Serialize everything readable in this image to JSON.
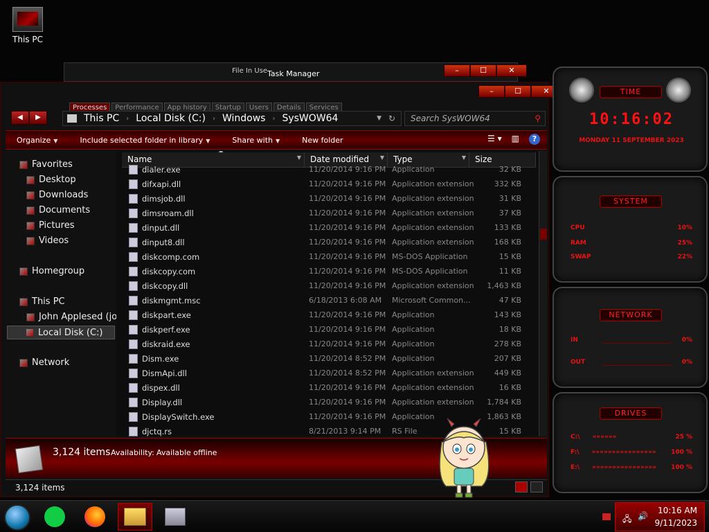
{
  "desktop": {
    "this_pc_label": "This PC"
  },
  "bg_windows": {
    "file_in_use": "File In Use",
    "task_manager": "Task Manager",
    "tm_tabs": [
      "Processes",
      "Performance",
      "App history",
      "Startup",
      "Users",
      "Details",
      "Services"
    ]
  },
  "address": {
    "crumbs": [
      "This PC",
      "Local Disk (C:)",
      "Windows",
      "SysWOW64"
    ],
    "search_placeholder": "Search SysWOW64"
  },
  "cmdbar": {
    "organize": "Organize",
    "include": "Include selected folder in library",
    "share": "Share with",
    "new_folder": "New folder"
  },
  "nav": {
    "favorites": "Favorites",
    "desktop": "Desktop",
    "downloads": "Downloads",
    "documents": "Documents",
    "pictures": "Pictures",
    "videos": "Videos",
    "homegroup": "Homegroup",
    "this_pc": "This PC",
    "user": "John Applesed (joh",
    "local_disk": "Local Disk (C:)",
    "network": "Network"
  },
  "columns": {
    "name": "Name",
    "date": "Date modified",
    "type": "Type",
    "size": "Size"
  },
  "files": [
    {
      "name": "dialer.exe",
      "date": "11/20/2014 9:16 PM",
      "type": "Application",
      "size": "32 KB",
      "icon": "exe-icon"
    },
    {
      "name": "difxapi.dll",
      "date": "11/20/2014 9:16 PM",
      "type": "Application extension",
      "size": "332 KB",
      "icon": "dll-icon"
    },
    {
      "name": "dimsjob.dll",
      "date": "11/20/2014 9:16 PM",
      "type": "Application extension",
      "size": "31 KB",
      "icon": "dll-icon"
    },
    {
      "name": "dimsroam.dll",
      "date": "11/20/2014 9:16 PM",
      "type": "Application extension",
      "size": "37 KB",
      "icon": "dll-icon"
    },
    {
      "name": "dinput.dll",
      "date": "11/20/2014 9:16 PM",
      "type": "Application extension",
      "size": "133 KB",
      "icon": "dll-icon"
    },
    {
      "name": "dinput8.dll",
      "date": "11/20/2014 9:16 PM",
      "type": "Application extension",
      "size": "168 KB",
      "icon": "dll-icon"
    },
    {
      "name": "diskcomp.com",
      "date": "11/20/2014 9:16 PM",
      "type": "MS-DOS Application",
      "size": "15 KB",
      "icon": "com-icon"
    },
    {
      "name": "diskcopy.com",
      "date": "11/20/2014 9:16 PM",
      "type": "MS-DOS Application",
      "size": "11 KB",
      "icon": "com-icon"
    },
    {
      "name": "diskcopy.dll",
      "date": "11/20/2014 9:16 PM",
      "type": "Application extension",
      "size": "1,463 KB",
      "icon": "dll-icon"
    },
    {
      "name": "diskmgmt.msc",
      "date": "6/18/2013 6:08 AM",
      "type": "Microsoft Common...",
      "size": "47 KB",
      "icon": "msc-icon"
    },
    {
      "name": "diskpart.exe",
      "date": "11/20/2014 9:16 PM",
      "type": "Application",
      "size": "143 KB",
      "icon": "exe-icon"
    },
    {
      "name": "diskperf.exe",
      "date": "11/20/2014 9:16 PM",
      "type": "Application",
      "size": "18 KB",
      "icon": "exe-icon"
    },
    {
      "name": "diskraid.exe",
      "date": "11/20/2014 9:16 PM",
      "type": "Application",
      "size": "278 KB",
      "icon": "exe-icon"
    },
    {
      "name": "Dism.exe",
      "date": "11/20/2014 8:52 PM",
      "type": "Application",
      "size": "207 KB",
      "icon": "exe-icon"
    },
    {
      "name": "DismApi.dll",
      "date": "11/20/2014 8:52 PM",
      "type": "Application extension",
      "size": "449 KB",
      "icon": "dll-icon"
    },
    {
      "name": "dispex.dll",
      "date": "11/20/2014 9:16 PM",
      "type": "Application extension",
      "size": "16 KB",
      "icon": "dll-icon"
    },
    {
      "name": "Display.dll",
      "date": "11/20/2014 9:16 PM",
      "type": "Application extension",
      "size": "1,784 KB",
      "icon": "dll-icon"
    },
    {
      "name": "DisplaySwitch.exe",
      "date": "11/20/2014 9:16 PM",
      "type": "Application",
      "size": "1,863 KB",
      "icon": "exe-icon"
    },
    {
      "name": "djctq.rs",
      "date": "8/21/2013 9:14 PM",
      "type": "RS File",
      "size": "15 KB",
      "icon": "rs-icon"
    }
  ],
  "details": {
    "count": "3,124 items",
    "availability_label": "Availability:",
    "availability_value": "Available offline"
  },
  "status": {
    "items": "3,124 items"
  },
  "gadget": {
    "time_title": "TIME",
    "time": "10:16:02",
    "date": "MONDAY 11 SEPTEMBER 2023",
    "system_title": "SYSTEM",
    "cpu_label": "CPU",
    "cpu_value": "10%",
    "ram_label": "RAM",
    "ram_value": "25%",
    "swap_label": "SWAP",
    "swap_value": "22%",
    "network_title": "NETWORK",
    "in_label": "IN",
    "in_value": "0%",
    "out_label": "OUT",
    "out_value": "0%",
    "drives_title": "DRIVES",
    "drive_c_label": "C:\\",
    "drive_c_value": "25 %",
    "drive_f_label": "F:\\",
    "drive_f_value": "100 %",
    "drive_e_label": "E:\\",
    "drive_e_value": "100 %",
    "accent": "#ee1111"
  },
  "taskbar": {
    "time": "10:16 AM",
    "date": "9/11/2023"
  }
}
